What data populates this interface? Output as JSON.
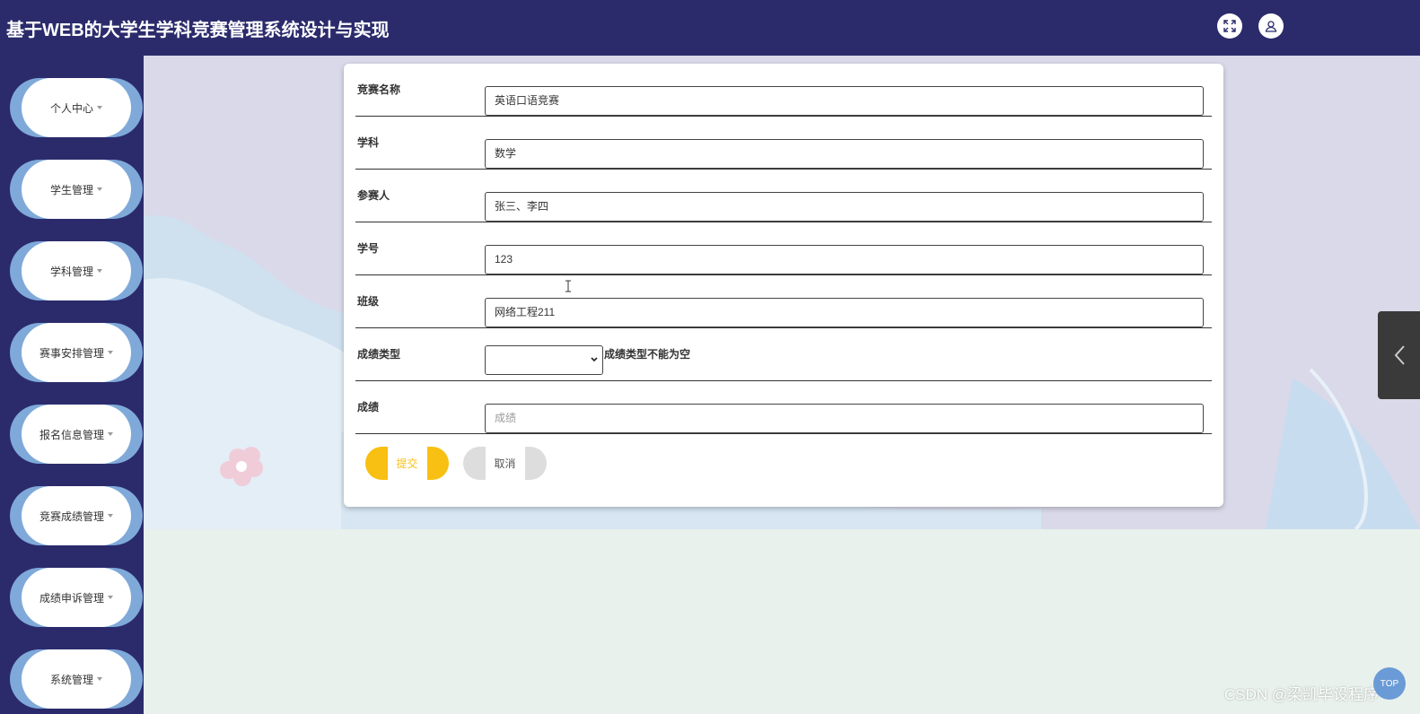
{
  "header": {
    "title": "基于WEB的大学生学科竞赛管理系统设计与实现",
    "icons": {
      "fullscreen": "fullscreen-icon",
      "user": "user-icon"
    }
  },
  "sidebar": {
    "items": [
      {
        "label": "个人中心"
      },
      {
        "label": "学生管理"
      },
      {
        "label": "学科管理"
      },
      {
        "label": "赛事安排管理"
      },
      {
        "label": "报名信息管理"
      },
      {
        "label": "竞赛成绩管理"
      },
      {
        "label": "成绩申诉管理"
      },
      {
        "label": "系统管理"
      }
    ]
  },
  "form": {
    "fields": [
      {
        "label": "竞赛名称",
        "value": "英语口语竞赛"
      },
      {
        "label": "学科",
        "value": "数学"
      },
      {
        "label": "参赛人",
        "value": "张三、李四"
      },
      {
        "label": "学号",
        "value": "123"
      },
      {
        "label": "班级",
        "value": "网络工程211"
      }
    ],
    "score_type": {
      "label": "成绩类型",
      "selected": "",
      "error": "成绩类型不能为空"
    },
    "score": {
      "label": "成绩",
      "placeholder": "成绩"
    },
    "submit_label": "提交",
    "cancel_label": "取消"
  },
  "watermark": "CSDN @梁凯毕设程序",
  "float_button": "TOP",
  "colors": {
    "header": "#2b2b6c",
    "accent_yellow": "#f8c012",
    "menu_blob": "#7fa9d9"
  }
}
